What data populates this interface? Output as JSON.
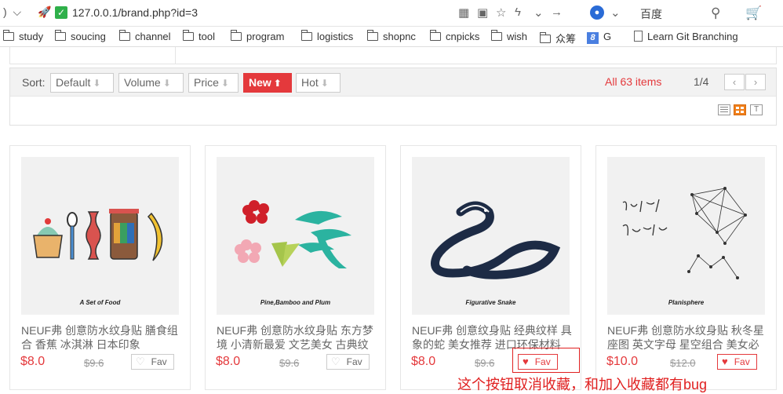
{
  "browser": {
    "url": "127.0.0.1/brand.php?id=3",
    "search_engine": "百度",
    "bookmarks": [
      {
        "label": "study"
      },
      {
        "label": "soucing"
      },
      {
        "label": "channel"
      },
      {
        "label": "tool"
      },
      {
        "label": "program"
      },
      {
        "label": "logistics"
      },
      {
        "label": "shopnc"
      },
      {
        "label": "cnpicks"
      },
      {
        "label": "wish"
      },
      {
        "label": "众筹"
      },
      {
        "label": "G"
      },
      {
        "label": "Learn Git Branching"
      }
    ]
  },
  "sort": {
    "label": "Sort:",
    "options": [
      {
        "label": "Default",
        "arrow": "⬇"
      },
      {
        "label": "Volume",
        "arrow": "⬇"
      },
      {
        "label": "Price",
        "arrow": "⬇"
      },
      {
        "label": "New",
        "arrow": "⬆"
      },
      {
        "label": "Hot",
        "arrow": "⬇"
      }
    ],
    "active": "New",
    "total": "All 63 items",
    "page": "1/4",
    "prev": "‹",
    "next": "›",
    "text_view_glyph": "T"
  },
  "products": [
    {
      "caption": "A Set of Food",
      "name": "NEUF弗 创意防水纹身贴 膳食组合 香蕉 冰淇淋 日本印象",
      "price": "$8.0",
      "original_price": "$9.6",
      "fav_label": "Fav",
      "favorited": false
    },
    {
      "caption": "Pine,Bamboo and Plum",
      "name": "NEUF弗 创意防水纹身贴 东方梦境 小清新最爱 文艺美女 古典纹",
      "price": "$8.0",
      "original_price": "$9.6",
      "fav_label": "Fav",
      "favorited": false
    },
    {
      "caption": "Figurative Snake",
      "name": "NEUF弗 创意纹身贴 经典纹样 具象的蛇 美女推荐 进口环保材料",
      "price": "$8.0",
      "original_price": "$9.6",
      "fav_label": "Fav",
      "favorited": true
    },
    {
      "caption": "Planisphere",
      "name": "NEUF弗 创意防水纹身贴 秋冬星座图 英文字母 星空组合 美女必",
      "price": "$10.0",
      "original_price": "$12.0",
      "fav_label": "Fav",
      "favorited": true
    }
  ],
  "annotation": {
    "text": "这个按钮取消收藏，和加入收藏都有bug",
    "color": "#e02020"
  },
  "colors": {
    "accent": "#e4393c",
    "grid_view": "#f07f1a"
  }
}
